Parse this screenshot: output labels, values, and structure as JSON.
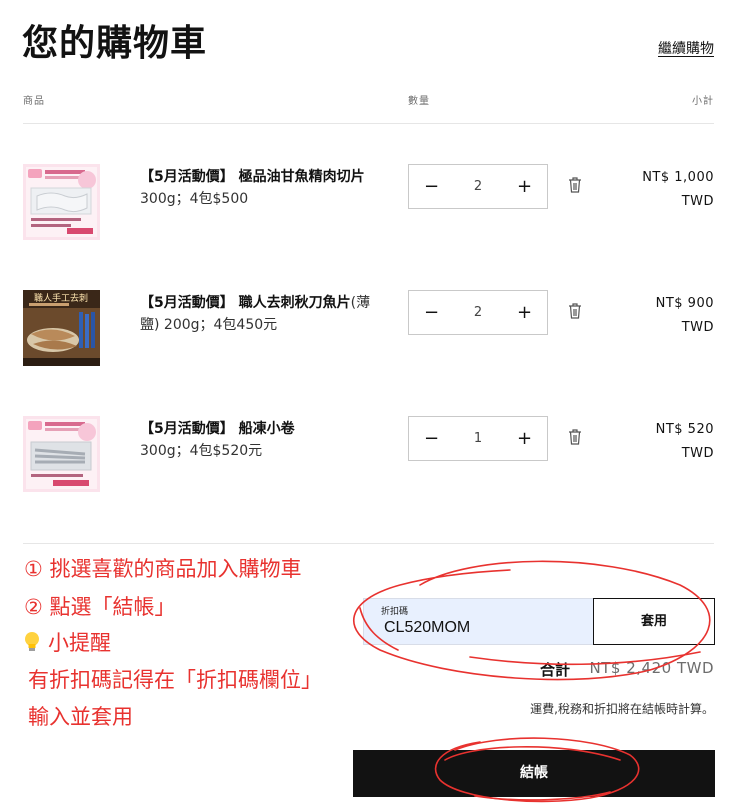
{
  "header": {
    "title": "您的購物車",
    "continue_link": "繼續購物"
  },
  "columns": {
    "product": "商品",
    "quantity": "數量",
    "subtotal": "小計"
  },
  "items": [
    {
      "name": "【5月活動價】 極品油甘魚精肉切片",
      "spec": " 300g；4包$500",
      "quantity": "2",
      "price_line1": "NT$ 1,000",
      "price_line2": "TWD",
      "thumb_style": "pink-poster"
    },
    {
      "name": "【5月活動價】 職人去刺秋刀魚片",
      "spec": "(薄鹽) 200g；4包450元",
      "quantity": "2",
      "price_line1": "NT$ 900",
      "price_line2": "TWD",
      "thumb_style": "dark-poster",
      "thumb_text": "職人手工去刺"
    },
    {
      "name": "【5月活動價】 船凍小卷",
      "spec": "300g；4包$520元",
      "quantity": "1",
      "price_line1": "NT$ 520",
      "price_line2": "TWD",
      "thumb_style": "pink-poster"
    }
  ],
  "icons": {
    "minus": "minus-icon",
    "plus": "plus-icon",
    "trash": "trash-icon",
    "bulb": "lightbulb-icon"
  },
  "annotations": {
    "step1": "① 挑選喜歡的商品加入購物車",
    "step2": "② 點選「結帳」",
    "tip_title": "小提醒",
    "tip_line1": "有折扣碼記得在「折扣碼欄位」",
    "tip_line2": "輸入並套用"
  },
  "discount": {
    "label": "折扣碼",
    "value": "CL520MOM",
    "apply_label": "套用"
  },
  "summary": {
    "total_label": "合計",
    "total_value": "NT$ 2,420 TWD",
    "tax_note": "運費,稅務和折扣將在結帳時計算。"
  },
  "checkout": {
    "label": "結帳"
  },
  "colors": {
    "annotation_red": "#e8322f",
    "checkout_bg": "#121212",
    "discount_bg": "#e8f0fe"
  }
}
